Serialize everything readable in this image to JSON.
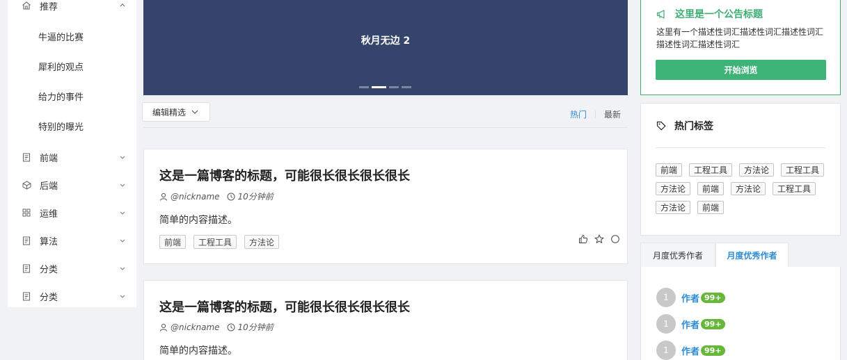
{
  "sidebar": {
    "recommend": {
      "label": "推荐",
      "icon": "home-icon",
      "expanded": true
    },
    "sub_items": [
      "牛逼的比赛",
      "犀利的观点",
      "给力的事件",
      "特别的曝光"
    ],
    "items": [
      {
        "label": "前端",
        "icon": "file-icon"
      },
      {
        "label": "后端",
        "icon": "cube-icon"
      },
      {
        "label": "运维",
        "icon": "grid-icon"
      },
      {
        "label": "算法",
        "icon": "file-icon"
      },
      {
        "label": "分类",
        "icon": "file-icon"
      },
      {
        "label": "分类",
        "icon": "file-icon"
      }
    ]
  },
  "carousel": {
    "title": "秋月无边 2",
    "slide_count": 4,
    "active_index": 1,
    "background": "#34446b"
  },
  "filter": {
    "select_label": "编辑精选",
    "sort_hot": "热门",
    "sort_new": "最新",
    "active_sort": "热门"
  },
  "posts": [
    {
      "title": "这是一篇博客的标题，可能很长很长很长很长",
      "author": "@nickname",
      "time": "10分钟前",
      "description": "简单的内容描述。",
      "tags": [
        "前端",
        "工程工具",
        "方法论"
      ]
    },
    {
      "title": "这是一篇博客的标题，可能很长很长很长很长",
      "author": "@nickname",
      "time": "10分钟前",
      "description": "简单的内容描述。",
      "tags": []
    }
  ],
  "notice": {
    "title": "这里是一个公告标题",
    "description": "这里有一个描述性词汇描述性词汇描述性词汇描述性词汇描述性词汇",
    "button": "开始浏览",
    "accent": "#3fae75"
  },
  "hot_tags": {
    "title": "热门标签",
    "tags": [
      "前端",
      "工程工具",
      "方法论",
      "工程工具",
      "方法论",
      "前端",
      "方法论",
      "工程工具",
      "方法论",
      "前端"
    ]
  },
  "authors": {
    "tabs": [
      "月度优秀作者",
      "月度优秀作者"
    ],
    "active_tab": 1,
    "list": [
      {
        "rank": "1",
        "name": "作者",
        "badge": "99+"
      },
      {
        "rank": "1",
        "name": "作者",
        "badge": "99+"
      },
      {
        "rank": "1",
        "name": "作者",
        "badge": "99+"
      }
    ]
  }
}
